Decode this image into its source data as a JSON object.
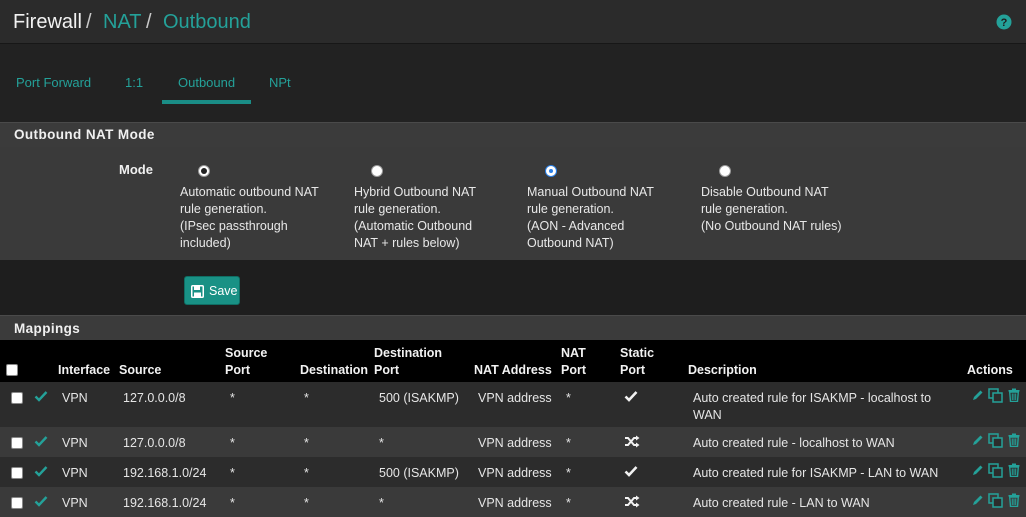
{
  "breadcrumb": {
    "part1": "Firewall",
    "sep1": "/",
    "part2": "NAT",
    "sep2": "/",
    "part3": "Outbound"
  },
  "tabs": [
    {
      "label": "Port Forward"
    },
    {
      "label": "1:1"
    },
    {
      "label": "Outbound"
    },
    {
      "label": "NPt"
    }
  ],
  "mode_panel": {
    "title": "Outbound NAT Mode",
    "label": "Mode",
    "options": [
      {
        "lines": [
          "Automatic outbound NAT",
          "rule generation.",
          "(IPsec passthrough",
          "included)"
        ]
      },
      {
        "lines": [
          "Hybrid Outbound NAT",
          "rule generation.",
          "(Automatic Outbound",
          "NAT + rules below)"
        ]
      },
      {
        "lines": [
          "Manual Outbound NAT",
          "rule generation.",
          "(AON - Advanced",
          "Outbound NAT)"
        ]
      },
      {
        "lines": [
          "Disable Outbound NAT",
          "rule generation.",
          "(No Outbound NAT rules)"
        ]
      }
    ],
    "save_label": "Save"
  },
  "mappings": {
    "title": "Mappings",
    "headers": {
      "interface": "Interface",
      "source": "Source",
      "source_port_1": "Source",
      "source_port_2": "Port",
      "destination": "Destination",
      "destination_port_1": "Destination",
      "destination_port_2": "Port",
      "nat_address": "NAT Address",
      "nat_port_1": "NAT",
      "nat_port_2": "Port",
      "static_port_1": "Static",
      "static_port_2": "Port",
      "description": "Description",
      "actions": "Actions"
    },
    "rows": [
      {
        "interface": "VPN",
        "source": "127.0.0.0/8",
        "source_port": "*",
        "destination": "*",
        "destination_port": "500 (ISAKMP)",
        "nat_address": "VPN address",
        "nat_port": "*",
        "static_icon": "checkmark-icon",
        "description_1": "Auto created rule for ISAKMP - localhost to",
        "description_2": "WAN"
      },
      {
        "interface": "VPN",
        "source": "127.0.0.0/8",
        "source_port": "*",
        "destination": "*",
        "destination_port": "*",
        "nat_address": "VPN address",
        "nat_port": "*",
        "static_icon": "shuffle-icon",
        "description_1": "Auto created rule - localhost to WAN",
        "description_2": ""
      },
      {
        "interface": "VPN",
        "source": "192.168.1.0/24",
        "source_port": "*",
        "destination": "*",
        "destination_port": "500 (ISAKMP)",
        "nat_address": "VPN address",
        "nat_port": "*",
        "static_icon": "checkmark-icon",
        "description_1": "Auto created rule for ISAKMP - LAN to WAN",
        "description_2": ""
      },
      {
        "interface": "VPN",
        "source": "192.168.1.0/24",
        "source_port": "*",
        "destination": "*",
        "destination_port": "*",
        "nat_address": "VPN address",
        "nat_port": "*",
        "static_icon": "shuffle-icon",
        "description_1": "Auto created rule - LAN to WAN",
        "description_2": ""
      }
    ]
  },
  "colors": {
    "accent": "#24a199",
    "button": "#199185",
    "header_bg": "#000000",
    "radio_selected": "#2a80e8"
  }
}
